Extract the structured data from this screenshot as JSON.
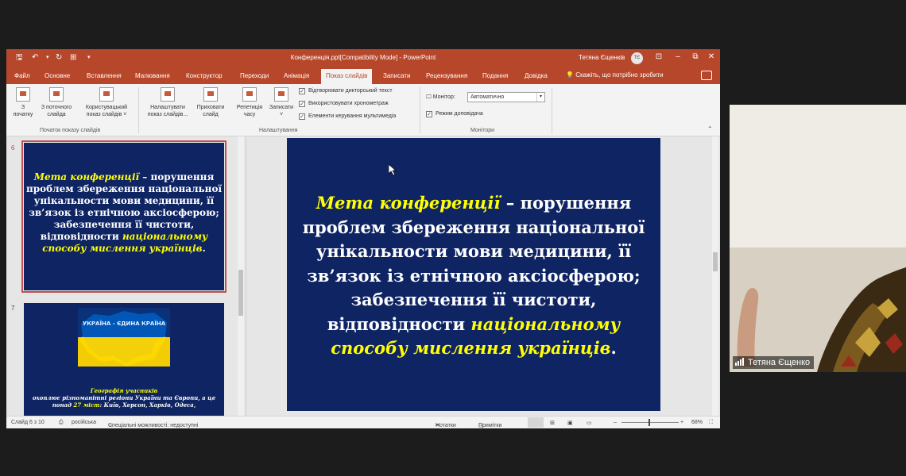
{
  "titlebar": {
    "title": "Конференція.ppt[Compatibility Mode]  -  PowerPoint",
    "user": "Тетяна Єщенків",
    "avatar_initials": "ТЄ"
  },
  "tabs": [
    "Файл",
    "Основне",
    "Вставлення",
    "Малювання",
    "Конструктор",
    "Переходи",
    "Анімація",
    "Показ слайдів",
    "Записати",
    "Рецензування",
    "Подання",
    "Довідка"
  ],
  "active_tab": "Показ слайдів",
  "tell_me": "Скажіть, що потрібно зробити",
  "ribbon": {
    "from_start": [
      "З",
      "початку"
    ],
    "from_current": [
      "З поточного",
      "слайда"
    ],
    "custom_show": [
      "Користувацький",
      "показ слайдів ˅"
    ],
    "setup_show": [
      "Налаштувати",
      "показ слайдів..."
    ],
    "hide_slide": [
      "Приховати",
      "слайд"
    ],
    "rehearse": [
      "Репетиція",
      "часу"
    ],
    "record": [
      "Записати",
      "˅"
    ],
    "play_narrations": "Відтворювати дикторський текст",
    "use_timings": "Використовувати хронометраж",
    "media_controls": "Елементи керування мультимедіа",
    "monitor_label": "Монітор:",
    "monitor_value": "Автоматично",
    "presenter_view": "Режим доповідача",
    "group_start": "Початок показу слайдів",
    "group_setup": "Налаштування",
    "group_monitors": "Монітори"
  },
  "slides": {
    "thumb6_num": "6",
    "thumb7_num": "7",
    "thumb7_map_caption": "УКРАЇНА - ЄДИНА КРАЇНА",
    "thumb7_heading": "Географія учасників",
    "thumb7_line1": "охоплює різноманітні регіони України та Європи, а це",
    "thumb7_line2_a": "понад ",
    "thumb7_line2_b": "27 міст",
    "thumb7_line2_c": ": Київ, Херсон, Харків, Одеса,"
  },
  "slide": {
    "highlight_1": "Мета конференції",
    "text_1": " – порушення проблем збереження національної унікальности мови медицини, її зв’язок із етнічною аксіосферою; забезпечення її чистоти, відповідности ",
    "highlight_2": "національному способу мислення українців",
    "end": "."
  },
  "status": {
    "slide_count": "Слайд 6 з 10",
    "language": "російська",
    "accessibility": "Спеціальні можливості: недоступні",
    "notes": "Нотатки",
    "comments": "Примітки",
    "zoom": "68%"
  },
  "webcam": {
    "participant": "Тетяна Єщенко"
  },
  "colors": {
    "accent": "#b7472a",
    "slide_bg": "#0f2463",
    "highlight": "#ffff00"
  }
}
